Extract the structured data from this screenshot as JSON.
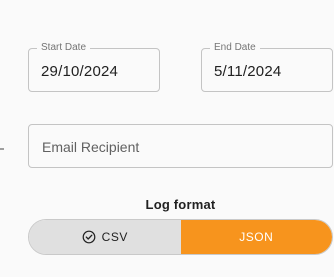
{
  "form": {
    "start_date": {
      "label": "Start Date",
      "value": "29/10/2024"
    },
    "end_date": {
      "label": "End Date",
      "value": "5/11/2024"
    },
    "email": {
      "placeholder": "Email Recipient",
      "value": ""
    }
  },
  "log_format": {
    "title": "Log format",
    "options": [
      {
        "label": "CSV",
        "icon": "check-circle-icon",
        "selected": false
      },
      {
        "label": "JSON",
        "selected": true
      }
    ]
  },
  "colors": {
    "accent": "#f7941d",
    "unselected": "#e0e0e0",
    "border": "#c4c4c4",
    "background": "#fafafa"
  }
}
